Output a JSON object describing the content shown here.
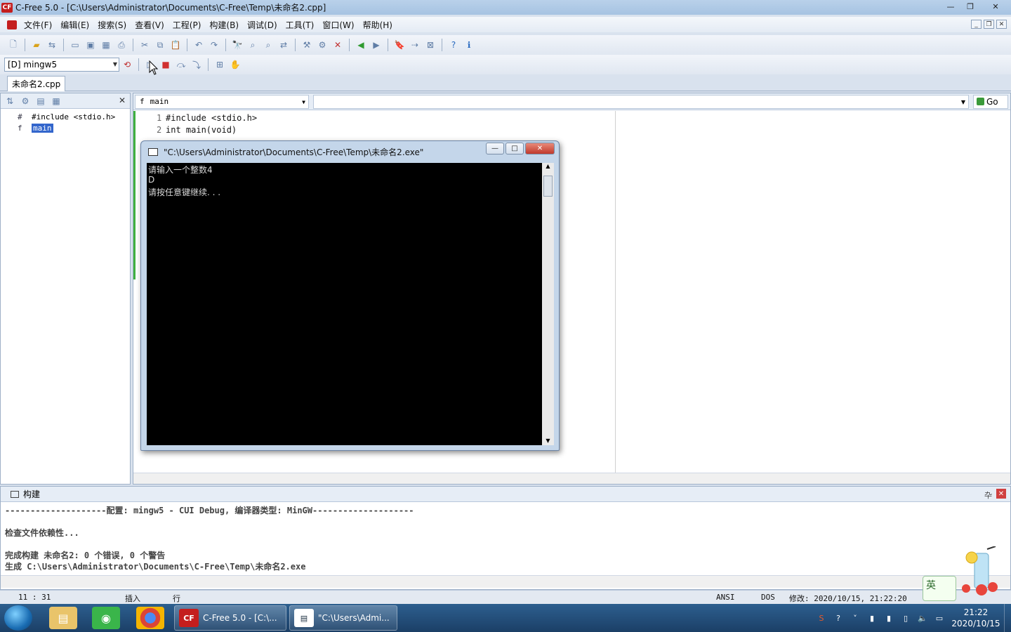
{
  "window": {
    "title": "C-Free 5.0 - [C:\\Users\\Administrator\\Documents\\C-Free\\Temp\\未命名2.cpp]",
    "logo_text": "CF",
    "minimize": "—",
    "maximize": "❐",
    "close": "✕"
  },
  "menu": {
    "items": [
      "文件(F)",
      "编辑(E)",
      "搜索(S)",
      "查看(V)",
      "工程(P)",
      "构建(B)",
      "调试(D)",
      "工具(T)",
      "窗口(W)",
      "帮助(H)"
    ]
  },
  "toolbar": {
    "config_value": "[D] mingw5"
  },
  "tabs": {
    "file_tab": "未命名2.cpp"
  },
  "left_panel": {
    "close": "✕",
    "tree": [
      {
        "icon": "#",
        "label": "#include <stdio.h>"
      },
      {
        "icon": "f",
        "label": "main"
      }
    ]
  },
  "editor": {
    "function_select": "main",
    "go_label": "Go",
    "lines": [
      {
        "no": "1",
        "text": "#include <stdio.h>"
      },
      {
        "no": "2",
        "text": "int main(void)"
      }
    ]
  },
  "console": {
    "title": "\"C:\\Users\\Administrator\\Documents\\C-Free\\Temp\\未命名2.exe\"",
    "output": [
      "请输入一个整数4",
      "D",
      "请按任意键继续. . ."
    ]
  },
  "build": {
    "title": "构建",
    "pin": "卆",
    "lines": [
      "--------------------配置: mingw5 - CUI Debug, 编译器类型: MinGW--------------------",
      "",
      "检查文件依赖性...",
      "",
      "完成构建 未命名2: 0 个错误, 0 个警告",
      "生成 C:\\Users\\Administrator\\Documents\\C-Free\\Temp\\未命名2.exe"
    ]
  },
  "status": {
    "position": "11 : 31",
    "mode": "插入",
    "row_label": "行",
    "encoding": "ANSI",
    "line_ending": "DOS",
    "modified": "修改: 2020/10/15, 21:22:20"
  },
  "ime": {
    "label": "英"
  },
  "taskbar": {
    "items": [
      {
        "label": "C-Free 5.0 - [C:\\...",
        "icon": "CF"
      },
      {
        "label": "\"C:\\Users\\Admi...",
        "icon": "▤"
      }
    ],
    "time": "21:22",
    "date": "2020/10/15"
  },
  "colors": {
    "accent_logo": "#c41e1e",
    "selection": "#3366cc",
    "console_bg": "#000000"
  }
}
